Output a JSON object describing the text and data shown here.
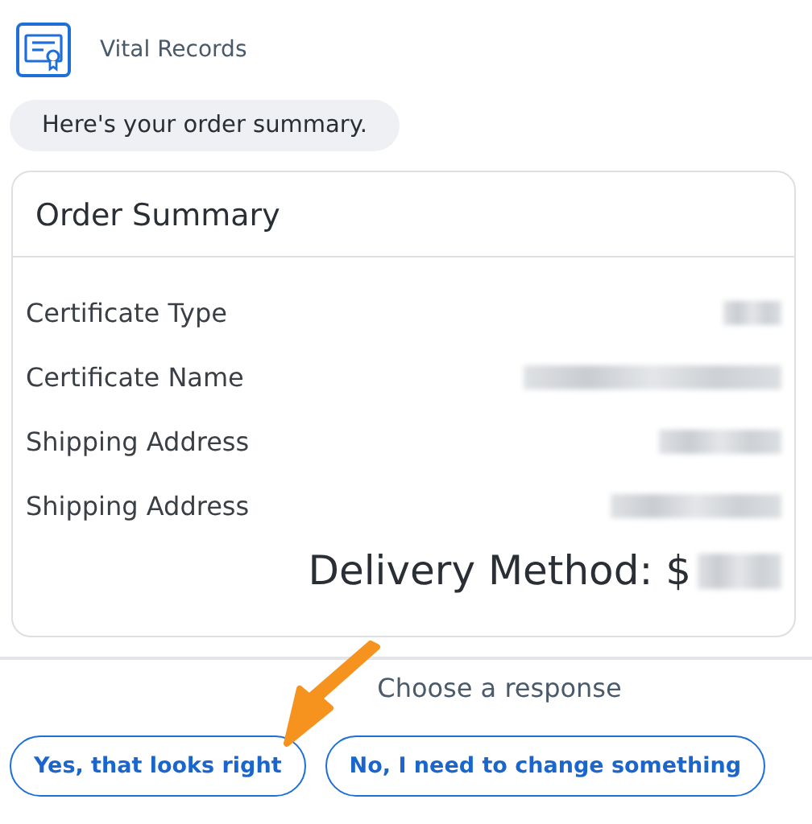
{
  "sender": {
    "name": "Vital Records"
  },
  "message": "Here's your order summary.",
  "summary": {
    "title": "Order Summary",
    "rows": [
      {
        "label": "Certificate Type"
      },
      {
        "label": "Certificate Name"
      },
      {
        "label": "Shipping Address"
      },
      {
        "label": "Shipping Address"
      }
    ],
    "total_label": "Delivery Method: $"
  },
  "prompt": "Choose a response",
  "responses": [
    "Yes, that looks right",
    "No, I need to change something"
  ]
}
